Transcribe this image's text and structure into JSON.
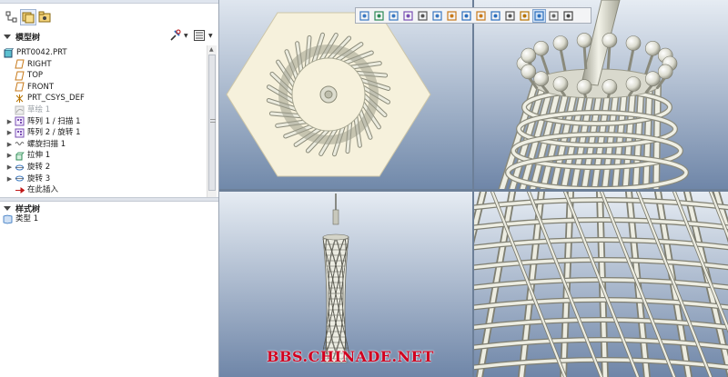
{
  "model_tree": {
    "header": "模型树",
    "items": [
      {
        "label": "PRT0042.PRT",
        "icon": "part-icon",
        "indent": 0,
        "expandable": false,
        "dim": false
      },
      {
        "label": "RIGHT",
        "icon": "datum-plane-icon",
        "indent": 1,
        "expandable": false,
        "dim": false
      },
      {
        "label": "TOP",
        "icon": "datum-plane-icon",
        "indent": 1,
        "expandable": false,
        "dim": false
      },
      {
        "label": "FRONT",
        "icon": "datum-plane-icon",
        "indent": 1,
        "expandable": false,
        "dim": false
      },
      {
        "label": "PRT_CSYS_DEF",
        "icon": "csys-icon",
        "indent": 1,
        "expandable": false,
        "dim": false
      },
      {
        "label": "草绘 1",
        "icon": "sketch-icon",
        "indent": 1,
        "expandable": false,
        "dim": true
      },
      {
        "label": "阵列 1 / 扫描 1",
        "icon": "pattern-icon",
        "indent": 1,
        "expandable": true,
        "dim": false
      },
      {
        "label": "阵列 2 / 旋转 1",
        "icon": "pattern-icon",
        "indent": 1,
        "expandable": true,
        "dim": false
      },
      {
        "label": "螺旋扫描 1",
        "icon": "helical-sweep-icon",
        "indent": 1,
        "expandable": true,
        "dim": false
      },
      {
        "label": "拉伸 1",
        "icon": "extrude-icon",
        "indent": 1,
        "expandable": true,
        "dim": false
      },
      {
        "label": "旋转 2",
        "icon": "revolve-icon",
        "indent": 1,
        "expandable": true,
        "dim": false
      },
      {
        "label": "旋转 3",
        "icon": "revolve-icon",
        "indent": 1,
        "expandable": true,
        "dim": false
      },
      {
        "label": "在此插入",
        "icon": "insert-here-icon",
        "indent": 1,
        "expandable": false,
        "dim": false
      }
    ]
  },
  "layer_tree": {
    "header": "样式树",
    "items": [
      {
        "label": "类型 1",
        "icon": "style-icon"
      }
    ]
  },
  "watermark": "BBS.CHINADE.NET",
  "colors": {
    "model_gray": "#d8d8cc",
    "viewport_bg_top": "#d9e2ee",
    "viewport_bg_bottom": "#6f86a8",
    "accent": "#2c6fbd",
    "watermark": "#d1001f"
  }
}
